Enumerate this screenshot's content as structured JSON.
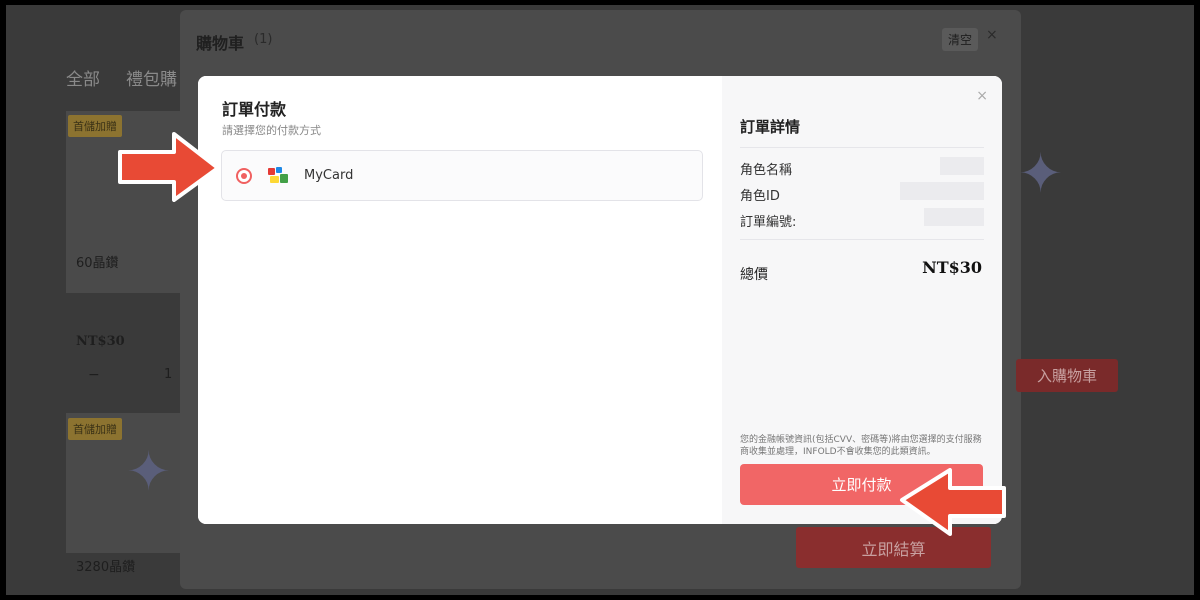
{
  "store": {
    "tab_all": "全部",
    "tab_gift": "禮包購",
    "badge_first": "首儲加贈",
    "item1_name": "60晶鑽",
    "item1_price": "NT$30",
    "qty_minus": "−",
    "qty_value": "1",
    "item2_name": "3280晶鑽",
    "add_cart_partial": "入購物車",
    "checkout_btn": "立即結算"
  },
  "cart": {
    "title": "購物車",
    "count": "(1)",
    "clear": "清空",
    "close": "×"
  },
  "modal": {
    "title": "訂單付款",
    "subtitle": "請選擇您的付款方式",
    "pay_option_label": "MyCard",
    "close": "×",
    "details": {
      "title": "訂單詳情",
      "role_name_label": "角色名稱",
      "role_id_label": "角色ID",
      "order_no_label": "訂單編號:",
      "total_label": "總價",
      "total_value": "NT$30"
    },
    "notice": "您的金融帳號資訊(包括CVV、密碼等)將由您選擇的支付服務商收集並處理，INFOLD不會收集您的此類資訊。",
    "pay_button": "立即付款"
  },
  "colors": {
    "accent": "#f16666",
    "arrow": "#e84a35"
  }
}
